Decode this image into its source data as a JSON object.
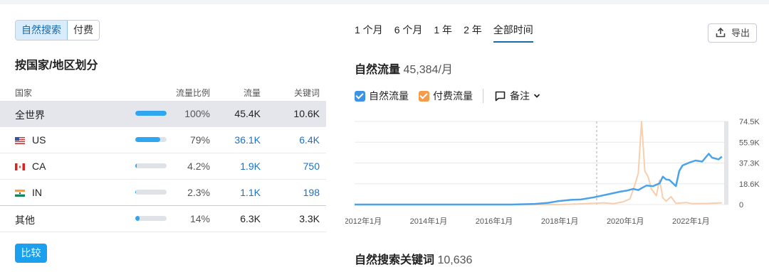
{
  "filters": {
    "organic_label": "自然搜索",
    "paid_label": "付费"
  },
  "geo": {
    "title": "按国家/地区划分",
    "headers": {
      "country": "国家",
      "share": "流量比例",
      "traffic": "流量",
      "keywords": "关键词"
    },
    "rows": [
      {
        "name": "全世界",
        "flag": "",
        "share_text": "100%",
        "share": 1.0,
        "traffic": "45.4K",
        "keywords": "10.6K"
      },
      {
        "name": "US",
        "flag": "us",
        "share_text": "79%",
        "share": 0.79,
        "traffic": "36.1K",
        "keywords": "6.4K"
      },
      {
        "name": "CA",
        "flag": "ca",
        "share_text": "4.2%",
        "share": 0.042,
        "traffic": "1.9K",
        "keywords": "750"
      },
      {
        "name": "IN",
        "flag": "in",
        "share_text": "2.3%",
        "share": 0.023,
        "traffic": "1.1K",
        "keywords": "198"
      },
      {
        "name": "其他",
        "flag": "",
        "share_text": "14%",
        "share": 0.14,
        "traffic": "6.3K",
        "keywords": "3.3K"
      }
    ],
    "compare_label": "比较"
  },
  "ranges": {
    "items": [
      "1 个月",
      "6 个月",
      "1 年",
      "2 年",
      "全部时间"
    ],
    "active": "全部时间"
  },
  "export_label": "导出",
  "traffic": {
    "title": "自然流量",
    "value": "45,384/月"
  },
  "legend": {
    "organic": "自然流量",
    "paid": "付费流量",
    "notes": "备注"
  },
  "keywords_section": {
    "title": "自然搜索关键词",
    "value": "10,636"
  },
  "colors": {
    "organic": "#4aa3ea",
    "paid": "#f8cfae",
    "accent": "#1ba0ef"
  },
  "chart_data": {
    "type": "line",
    "x_ticks": [
      "2012年1月",
      "2014年1月",
      "2016年1月",
      "2018年1月",
      "2020年1月",
      "2022年1月"
    ],
    "y_ticks": [
      "74.5K",
      "55.9K",
      "37.3K",
      "18.6K",
      "0"
    ],
    "ylim": [
      0,
      74500
    ],
    "series": [
      {
        "name": "自然流量",
        "x": [
          2011.7,
          2012.5,
          2013.5,
          2014.5,
          2015.5,
          2016.5,
          2017.2,
          2017.6,
          2017.9,
          2018.3,
          2018.6,
          2019.0,
          2019.4,
          2019.8,
          2020.0,
          2020.2,
          2020.35,
          2020.5,
          2020.6,
          2020.8,
          2021.0,
          2021.1,
          2021.2,
          2021.3,
          2021.5,
          2021.6,
          2021.7,
          2021.9,
          2022.1,
          2022.3,
          2022.5,
          2022.6,
          2022.8,
          2022.9
        ],
        "y": [
          0,
          0,
          0,
          0,
          0,
          0,
          600,
          1500,
          3000,
          4200,
          4500,
          6500,
          9000,
          11500,
          12500,
          14000,
          13000,
          15500,
          17000,
          16500,
          19000,
          25000,
          22500,
          22000,
          16500,
          30000,
          35000,
          37500,
          39500,
          38500,
          45500,
          42000,
          40500,
          43000
        ]
      },
      {
        "name": "付费流量",
        "x": [
          2011.7,
          2017.9,
          2018.5,
          2019.3,
          2019.6,
          2019.9,
          2020.1,
          2020.25,
          2020.35,
          2020.45,
          2020.55,
          2020.65,
          2020.75,
          2020.9,
          2021.0,
          2021.1,
          2021.2,
          2021.35,
          2021.5,
          2021.8,
          2022.0,
          2022.5,
          2022.9
        ],
        "y": [
          0,
          0,
          500,
          1500,
          800,
          2500,
          5000,
          18000,
          28000,
          74500,
          30000,
          25000,
          14000,
          8000,
          22000,
          6000,
          3000,
          7000,
          1000,
          1800,
          800,
          1000,
          1500
        ]
      }
    ]
  }
}
